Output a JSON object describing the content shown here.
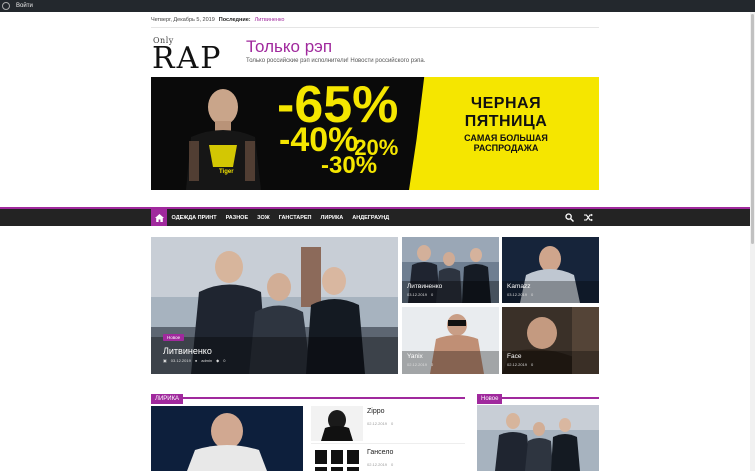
{
  "admin_bar": {
    "login_label": "Войти"
  },
  "top_bar": {
    "date": "Четверг, Декабрь 5, 2019",
    "latest_label": "Последние:",
    "latest_link": "Литвиненко"
  },
  "logo": {
    "only": "Only",
    "rap": "RAP"
  },
  "site": {
    "title": "Только рэп",
    "description": "Только российские рэп исполнители! Новости российского рэпа."
  },
  "banner": {
    "pct_65": "-65%",
    "pct_40": "-40%",
    "pct_20": "-20%",
    "pct_30": "-30%",
    "line1": "ЧЕРНАЯ",
    "line2": "ПЯТНИЦА",
    "line3": "САМАЯ БОЛЬШАЯ",
    "line4": "РАСПРОДАЖА",
    "shirt_text": "Tiger"
  },
  "nav": {
    "items": [
      "ОДЕЖДА ПРИНТ",
      "РАЗНОЕ",
      "ЗОЖ",
      "ГАНСТАРЕП",
      "ЛИРИКА",
      "АНДЕГРАУНД"
    ]
  },
  "featured": {
    "badge": "Новое",
    "title": "Литвиненко",
    "date": "03.12.2019",
    "author": "admin",
    "comments": "0"
  },
  "tiles": [
    {
      "title": "Литвиненко",
      "date": "03.12.2019",
      "comments": "0"
    },
    {
      "title": "Kamazz",
      "date": "03.12.2019",
      "comments": "0"
    },
    {
      "title": "Yanix",
      "date": "02.12.2019",
      "comments": "0"
    },
    {
      "title": "Face",
      "date": "02.12.2019",
      "comments": "0"
    }
  ],
  "sections": {
    "lyrics": "ЛИРИКА",
    "new": "Новое"
  },
  "list": [
    {
      "title": "Zippo",
      "date": "02.12.2019",
      "comments": "0"
    },
    {
      "title": "Гансело",
      "date": "02.12.2019",
      "comments": "0"
    }
  ],
  "colors": {
    "accent": "#a0299d",
    "nav_bg": "#232323",
    "banner_yellow": "#f5e600"
  }
}
